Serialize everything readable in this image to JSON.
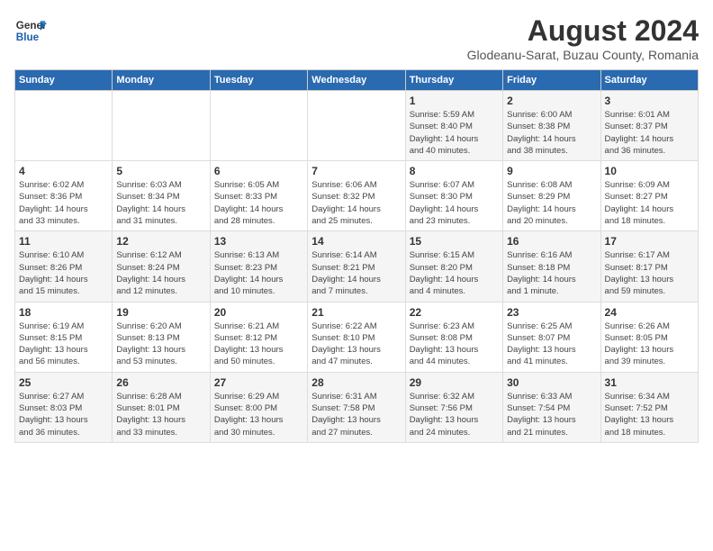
{
  "app": {
    "name_line1": "General",
    "name_line2": "Blue"
  },
  "title": "August 2024",
  "subtitle": "Glodeanu-Sarat, Buzau County, Romania",
  "days_of_week": [
    "Sunday",
    "Monday",
    "Tuesday",
    "Wednesday",
    "Thursday",
    "Friday",
    "Saturday"
  ],
  "weeks": [
    [
      {
        "day": "",
        "info": ""
      },
      {
        "day": "",
        "info": ""
      },
      {
        "day": "",
        "info": ""
      },
      {
        "day": "",
        "info": ""
      },
      {
        "day": "1",
        "info": "Sunrise: 5:59 AM\nSunset: 8:40 PM\nDaylight: 14 hours\nand 40 minutes."
      },
      {
        "day": "2",
        "info": "Sunrise: 6:00 AM\nSunset: 8:38 PM\nDaylight: 14 hours\nand 38 minutes."
      },
      {
        "day": "3",
        "info": "Sunrise: 6:01 AM\nSunset: 8:37 PM\nDaylight: 14 hours\nand 36 minutes."
      }
    ],
    [
      {
        "day": "4",
        "info": "Sunrise: 6:02 AM\nSunset: 8:36 PM\nDaylight: 14 hours\nand 33 minutes."
      },
      {
        "day": "5",
        "info": "Sunrise: 6:03 AM\nSunset: 8:34 PM\nDaylight: 14 hours\nand 31 minutes."
      },
      {
        "day": "6",
        "info": "Sunrise: 6:05 AM\nSunset: 8:33 PM\nDaylight: 14 hours\nand 28 minutes."
      },
      {
        "day": "7",
        "info": "Sunrise: 6:06 AM\nSunset: 8:32 PM\nDaylight: 14 hours\nand 25 minutes."
      },
      {
        "day": "8",
        "info": "Sunrise: 6:07 AM\nSunset: 8:30 PM\nDaylight: 14 hours\nand 23 minutes."
      },
      {
        "day": "9",
        "info": "Sunrise: 6:08 AM\nSunset: 8:29 PM\nDaylight: 14 hours\nand 20 minutes."
      },
      {
        "day": "10",
        "info": "Sunrise: 6:09 AM\nSunset: 8:27 PM\nDaylight: 14 hours\nand 18 minutes."
      }
    ],
    [
      {
        "day": "11",
        "info": "Sunrise: 6:10 AM\nSunset: 8:26 PM\nDaylight: 14 hours\nand 15 minutes."
      },
      {
        "day": "12",
        "info": "Sunrise: 6:12 AM\nSunset: 8:24 PM\nDaylight: 14 hours\nand 12 minutes."
      },
      {
        "day": "13",
        "info": "Sunrise: 6:13 AM\nSunset: 8:23 PM\nDaylight: 14 hours\nand 10 minutes."
      },
      {
        "day": "14",
        "info": "Sunrise: 6:14 AM\nSunset: 8:21 PM\nDaylight: 14 hours\nand 7 minutes."
      },
      {
        "day": "15",
        "info": "Sunrise: 6:15 AM\nSunset: 8:20 PM\nDaylight: 14 hours\nand 4 minutes."
      },
      {
        "day": "16",
        "info": "Sunrise: 6:16 AM\nSunset: 8:18 PM\nDaylight: 14 hours\nand 1 minute."
      },
      {
        "day": "17",
        "info": "Sunrise: 6:17 AM\nSunset: 8:17 PM\nDaylight: 13 hours\nand 59 minutes."
      }
    ],
    [
      {
        "day": "18",
        "info": "Sunrise: 6:19 AM\nSunset: 8:15 PM\nDaylight: 13 hours\nand 56 minutes."
      },
      {
        "day": "19",
        "info": "Sunrise: 6:20 AM\nSunset: 8:13 PM\nDaylight: 13 hours\nand 53 minutes."
      },
      {
        "day": "20",
        "info": "Sunrise: 6:21 AM\nSunset: 8:12 PM\nDaylight: 13 hours\nand 50 minutes."
      },
      {
        "day": "21",
        "info": "Sunrise: 6:22 AM\nSunset: 8:10 PM\nDaylight: 13 hours\nand 47 minutes."
      },
      {
        "day": "22",
        "info": "Sunrise: 6:23 AM\nSunset: 8:08 PM\nDaylight: 13 hours\nand 44 minutes."
      },
      {
        "day": "23",
        "info": "Sunrise: 6:25 AM\nSunset: 8:07 PM\nDaylight: 13 hours\nand 41 minutes."
      },
      {
        "day": "24",
        "info": "Sunrise: 6:26 AM\nSunset: 8:05 PM\nDaylight: 13 hours\nand 39 minutes."
      }
    ],
    [
      {
        "day": "25",
        "info": "Sunrise: 6:27 AM\nSunset: 8:03 PM\nDaylight: 13 hours\nand 36 minutes."
      },
      {
        "day": "26",
        "info": "Sunrise: 6:28 AM\nSunset: 8:01 PM\nDaylight: 13 hours\nand 33 minutes."
      },
      {
        "day": "27",
        "info": "Sunrise: 6:29 AM\nSunset: 8:00 PM\nDaylight: 13 hours\nand 30 minutes."
      },
      {
        "day": "28",
        "info": "Sunrise: 6:31 AM\nSunset: 7:58 PM\nDaylight: 13 hours\nand 27 minutes."
      },
      {
        "day": "29",
        "info": "Sunrise: 6:32 AM\nSunset: 7:56 PM\nDaylight: 13 hours\nand 24 minutes."
      },
      {
        "day": "30",
        "info": "Sunrise: 6:33 AM\nSunset: 7:54 PM\nDaylight: 13 hours\nand 21 minutes."
      },
      {
        "day": "31",
        "info": "Sunrise: 6:34 AM\nSunset: 7:52 PM\nDaylight: 13 hours\nand 18 minutes."
      }
    ]
  ]
}
